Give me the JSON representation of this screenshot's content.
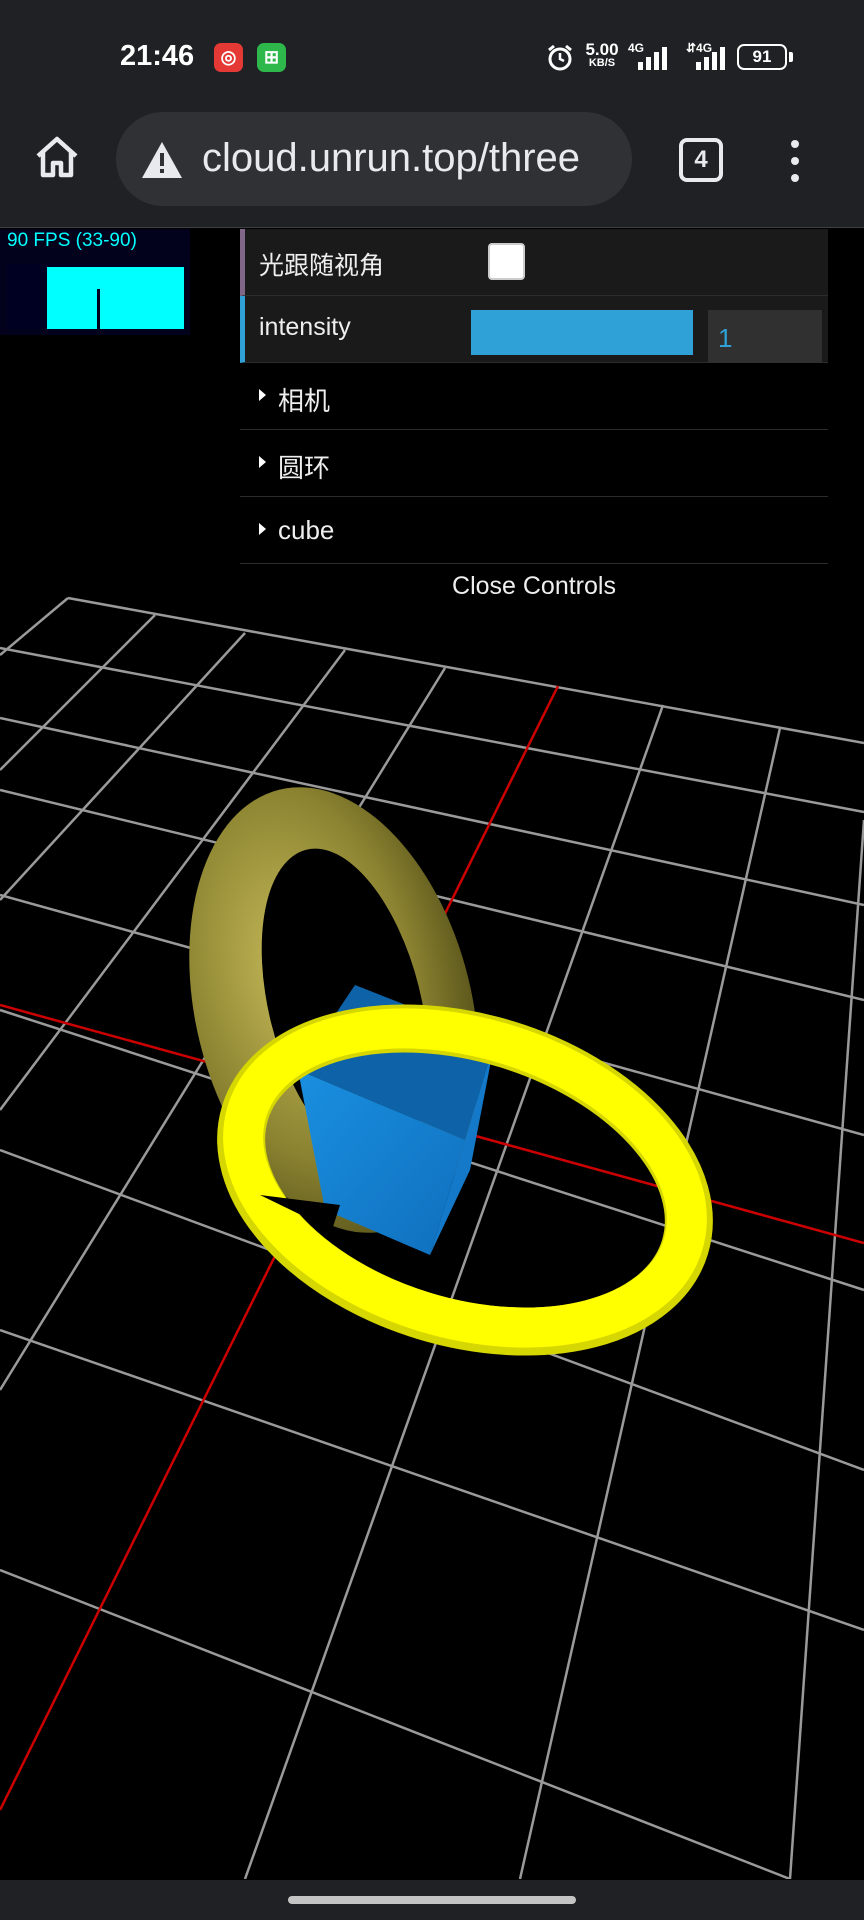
{
  "status_bar": {
    "time": "21:46",
    "badges": {
      "netease": "◎",
      "green": "⊞"
    },
    "net_speed_value": "5.00",
    "net_speed_unit": "KB/S",
    "sim1_label": "4G",
    "sim2_label": "⇵4G",
    "battery": "91"
  },
  "browser": {
    "url": "cloud.unrun.top/three",
    "tab_count": "4"
  },
  "fps_monitor": {
    "text": "90 FPS (33-90)"
  },
  "gui": {
    "light_follow_label": "光跟随视角",
    "light_follow_checked": false,
    "intensity_label": "intensity",
    "intensity_value": "1",
    "intensity_fraction": 1.0,
    "folders": [
      "相机",
      "圆环",
      "cube"
    ],
    "close_label": "Close Controls"
  },
  "colors": {
    "accent_number": "#2fa1d6",
    "accent_boolean": "#806787",
    "torus_yellow": "#ffff00",
    "torus_olive": "#8a8230",
    "cube_blue": "#1a8fe0",
    "grid": "#9a9a9a",
    "axis_red": "#cc0000"
  }
}
